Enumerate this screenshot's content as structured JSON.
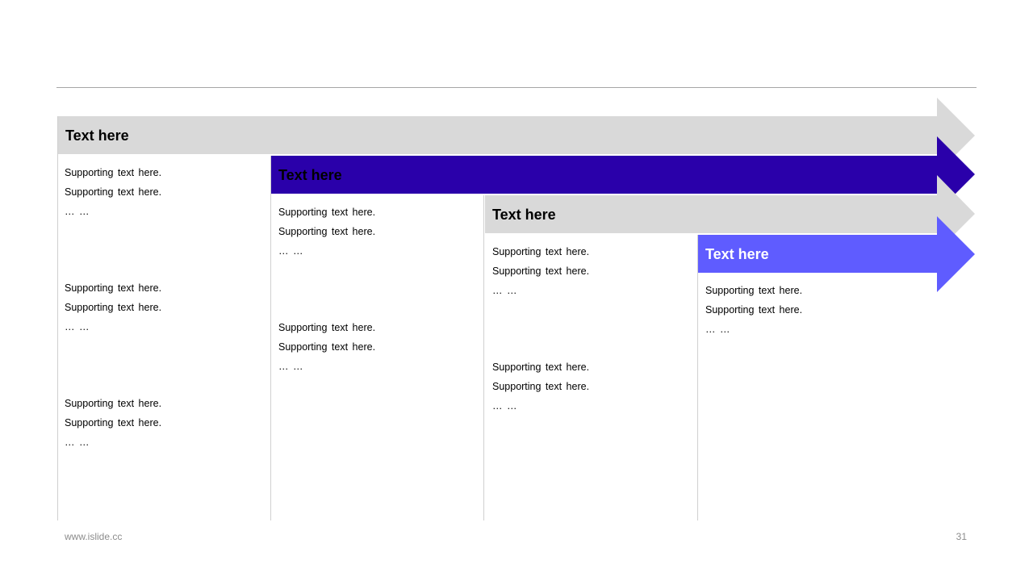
{
  "colors": {
    "arrow_gray": "#d9d9d9",
    "arrow_dark_purple": "#2a00aa",
    "arrow_light_purple": "#5f5cff",
    "rule": "#a6a6a6",
    "footer_text": "#8c8c8c"
  },
  "stages": [
    {
      "title": "Text here",
      "groups": [
        [
          "Supporting text here.",
          "Supporting text here.",
          "… …"
        ],
        [
          "Supporting text here.",
          "Supporting text here.",
          "… …"
        ],
        [
          "Supporting text here.",
          "Supporting text here.",
          "… …"
        ]
      ]
    },
    {
      "title": "Text here",
      "groups": [
        [
          "Supporting text here.",
          "Supporting text here.",
          "… …"
        ],
        [
          "Supporting text here.",
          "Supporting text here.",
          "… …"
        ]
      ]
    },
    {
      "title": "Text here",
      "groups": [
        [
          "Supporting text here.",
          "Supporting text here.",
          "… …"
        ],
        [
          "Supporting text here.",
          "Supporting text here.",
          "… …"
        ]
      ]
    },
    {
      "title": "Text here",
      "groups": [
        [
          "Supporting text here.",
          "Supporting text here.",
          "… …"
        ]
      ]
    }
  ],
  "footer": {
    "url": "www.islide.cc",
    "page_number": "31"
  }
}
